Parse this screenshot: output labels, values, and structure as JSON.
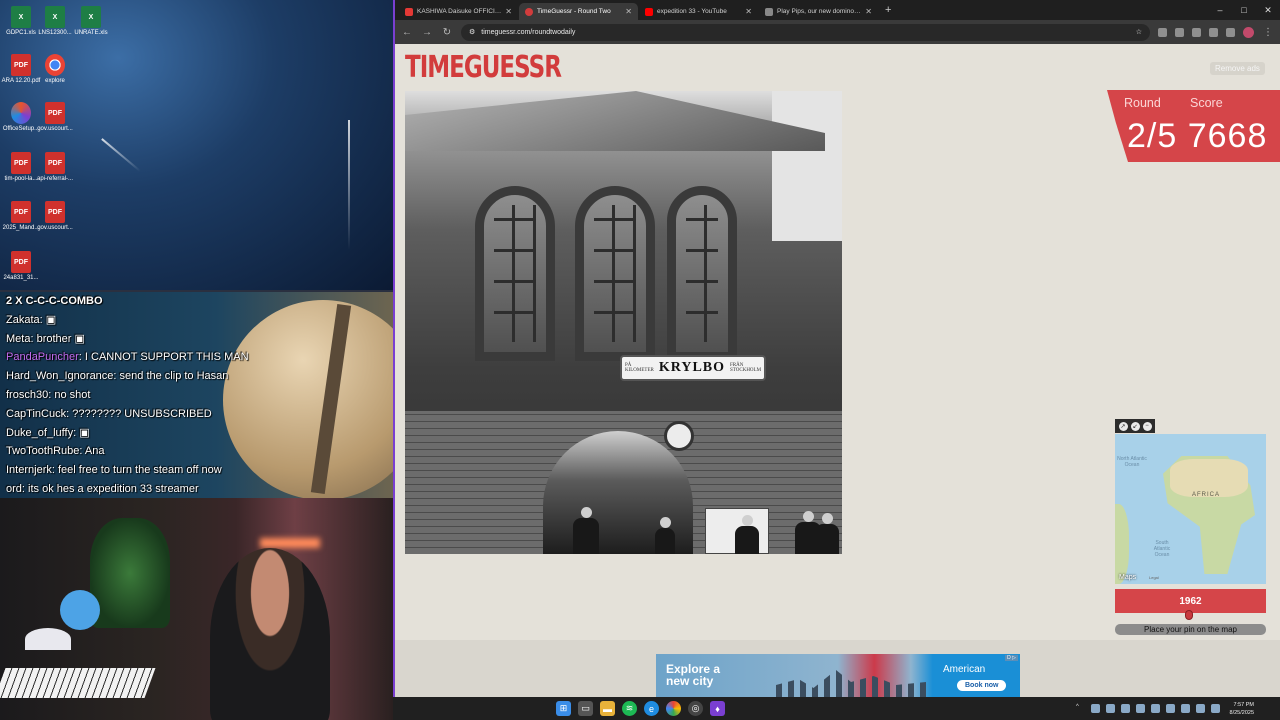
{
  "desktop": {
    "icons": [
      {
        "label": "GDPC1.xls",
        "type": "xls"
      },
      {
        "label": "LNS12300...",
        "type": "xls"
      },
      {
        "label": "UNRATE.xls",
        "type": "xls"
      },
      {
        "label": "ARA 12.20.pdf",
        "type": "pdf"
      },
      {
        "label": "explore",
        "type": "chrome"
      },
      {
        "label": "OfficeSetup...",
        "type": "office"
      },
      {
        "label": "gov.uscourt...",
        "type": "pdf"
      },
      {
        "label": "tim-pool-la...",
        "type": "pdf"
      },
      {
        "label": "api-referral-...",
        "type": "pdf"
      },
      {
        "label": "2025_Mand...",
        "type": "pdf"
      },
      {
        "label": "gov.uscourt...",
        "type": "pdf"
      },
      {
        "label": "24a831_31...",
        "type": "pdf"
      }
    ]
  },
  "chat": {
    "combo": "2 X C-C-C-COMBO",
    "messages": [
      {
        "user": "Zakata",
        "text": ""
      },
      {
        "user": "Meta",
        "text": "brother"
      },
      {
        "user": "PandaPuncher",
        "text": "I CANNOT SUPPORT THIS MAN"
      },
      {
        "user": "Hard_Won_Ignorance",
        "text": "send the clip to Hasan"
      },
      {
        "user": "frosch30",
        "text": "no shot"
      },
      {
        "user": "CapTinCuck",
        "text": "???????? UNSUBSCRIBED"
      },
      {
        "user": "Duke_of_luffy",
        "text": ""
      },
      {
        "user": "TwoToothRube",
        "text": "Ana"
      },
      {
        "user": "Internjerk",
        "text": "feel free to turn the steam off now"
      },
      {
        "user": "ord",
        "text": "its ok hes a expedition 33 streamer"
      }
    ]
  },
  "browser": {
    "tabs": [
      {
        "label": "KASHIWA Daisuke OFFICIAL CH...",
        "color": "#e53935",
        "active": false
      },
      {
        "label": "TimeGuessr - Round Two",
        "color": "#d23c3c",
        "active": true
      },
      {
        "label": "expedition 33 - YouTube",
        "color": "#ff0000",
        "active": false
      },
      {
        "label": "Play Pips, our new dominoes p...",
        "color": "#888888",
        "active": false
      }
    ],
    "new_tab": "+",
    "url": "timeguessr.com/roundtwodaily",
    "window_controls": {
      "min": "–",
      "max": "□",
      "close": "✕"
    }
  },
  "page": {
    "logo": "TIMEGUESSR",
    "remove_ads": "Remove ads",
    "photo_sign": {
      "left": "PÅ KILOMETER",
      "name": "KRYLBO",
      "right": "FRÅN STOCKHOLM"
    },
    "round_label": "Round",
    "score_label": "Score",
    "round_value": "2/5",
    "score_value": "7668",
    "map": {
      "labels": {
        "north_atlantic": "North Atlantic Ocean",
        "africa": "AFRICA",
        "south_atlantic": "South Atlantic Ocean"
      },
      "brand": "Maps",
      "legal": "Legal"
    },
    "year": "1962",
    "slider_fraction": 0.5,
    "place_pin": "Place your pin on the map"
  },
  "ad": {
    "headline_1": "Explore a",
    "headline_2": "new city",
    "brand": "American",
    "cta": "Book now",
    "info": "D ▷"
  },
  "taskbar": {
    "time": "7:57 PM",
    "date": "8/25/2025"
  }
}
